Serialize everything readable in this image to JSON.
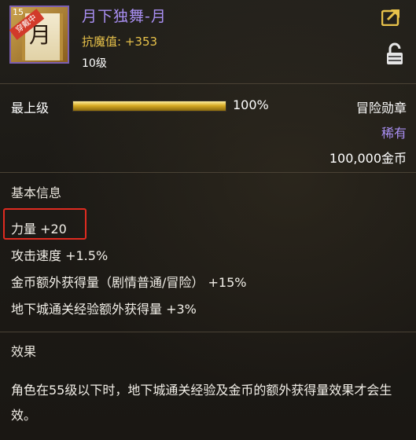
{
  "item": {
    "number": "15",
    "badge": "穿戴中",
    "icon_glyph": "月",
    "name": "月下独舞-月",
    "stat_label": "抗魔值:",
    "stat_value": "+353",
    "level": "10级"
  },
  "header_icons": {
    "share": "share-export-icon",
    "lock": "lock-icon"
  },
  "grade": {
    "label": "最上级",
    "progress": 100,
    "progress_text": "100%",
    "category": "冒险勋章",
    "rarity": "稀有",
    "price": "100,000金币"
  },
  "basic_info": {
    "title": "基本信息",
    "attributes": [
      "力量 +20",
      "攻击速度 +1.5%",
      "金币额外获得量（剧情普通/冒险） +15%",
      "地下城通关经验额外获得量 +3%"
    ]
  },
  "effect": {
    "title": "效果",
    "text": "角色在55级以下时，地下城通关经验及金币的额外获得量效果才会生效。"
  },
  "colors": {
    "name": "#a98ff2",
    "rarity": "#a98ff2",
    "stat": "#e8c24a",
    "highlight": "#e02b20",
    "bar": "#d7ab24"
  }
}
